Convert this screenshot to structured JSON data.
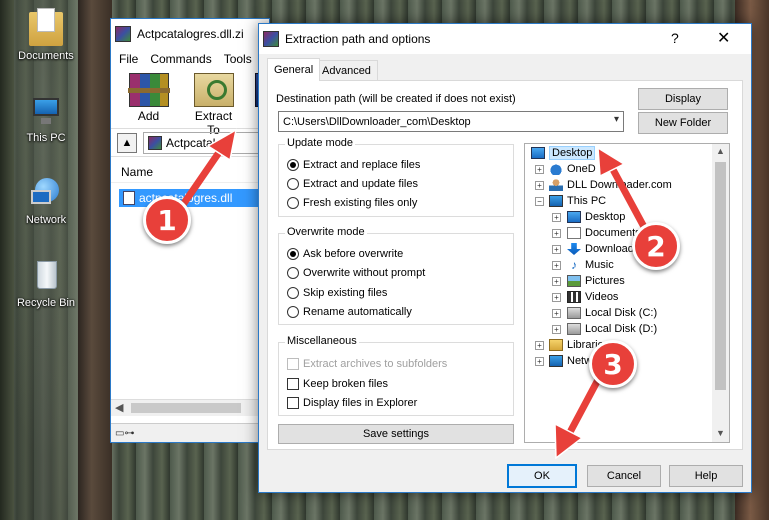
{
  "desktop": {
    "icons": [
      {
        "label": "Documents",
        "icon": "folder-documents-icon"
      },
      {
        "label": "This PC",
        "icon": "computer-icon"
      },
      {
        "label": "Network",
        "icon": "network-icon"
      },
      {
        "label": "Recycle Bin",
        "icon": "recycle-bin-icon"
      }
    ]
  },
  "winrar": {
    "title": "Actpcatalogres.dll.zi",
    "menu": [
      "File",
      "Commands",
      "Tools"
    ],
    "toolbar": {
      "add": "Add",
      "extract_to": "Extract To",
      "third": "T"
    },
    "address": "Actpcatalog",
    "column_name": "Name",
    "file": "actpcatalogres.dll"
  },
  "dialog": {
    "title": "Extraction path and options",
    "help": "?",
    "close": "✕",
    "tabs": [
      "General",
      "Advanced"
    ],
    "dest_label": "Destination path (will be created if does not exist)",
    "dest_value": "C:\\Users\\DllDownloader_com\\Desktop",
    "display_btn": "Display",
    "new_folder_btn": "New Folder",
    "update_mode": {
      "title": "Update mode",
      "options": [
        "Extract and replace files",
        "Extract and update files",
        "Fresh existing files only"
      ],
      "selected": 0
    },
    "overwrite_mode": {
      "title": "Overwrite mode",
      "options": [
        "Ask before overwrite",
        "Overwrite without prompt",
        "Skip existing files",
        "Rename automatically"
      ],
      "selected": 0
    },
    "misc": {
      "title": "Miscellaneous",
      "options": [
        "Extract archives to subfolders",
        "Keep broken files",
        "Display files in Explorer"
      ]
    },
    "save_settings": "Save settings",
    "tree": [
      {
        "label": "Desktop",
        "selected": true
      },
      {
        "label": "OneD"
      },
      {
        "label": "DLL Downloader.com"
      },
      {
        "label": "This PC"
      },
      {
        "label": "Desktop"
      },
      {
        "label": "Documents"
      },
      {
        "label": "Downloads"
      },
      {
        "label": "Music"
      },
      {
        "label": "Pictures"
      },
      {
        "label": "Videos"
      },
      {
        "label": "Local Disk (C:)"
      },
      {
        "label": "Local Disk (D:)"
      },
      {
        "label": "Libraries"
      },
      {
        "label": "Netw"
      }
    ],
    "ok": "OK",
    "cancel": "Cancel",
    "help_btn": "Help"
  },
  "annotations": {
    "badges": [
      "1",
      "2",
      "3"
    ],
    "color": "#e8403a"
  }
}
